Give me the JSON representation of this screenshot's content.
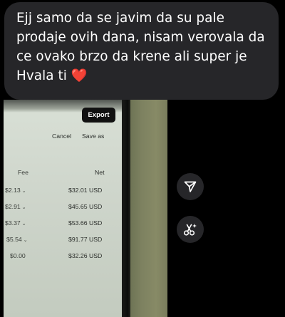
{
  "message": {
    "text": "Ejj samo da se javim da su pale prodaje ovih dana, nisam verovala da ce ovako brzo da krene ali super je Hvala ti",
    "emoji": "❤️"
  },
  "screenshot": {
    "export_label": "Export",
    "cancel_label": "Cancel",
    "save_as_label": "Save as",
    "fee_header": "Fee",
    "net_header": "Net",
    "rows": [
      {
        "fee": "$2.13",
        "net": "$32.01 USD"
      },
      {
        "fee": "$2.91",
        "net": "$45.65 USD"
      },
      {
        "fee": "$3.37",
        "net": "$53.66 USD"
      },
      {
        "fee": "$5.54",
        "net": "$91.77 USD"
      },
      {
        "fee": "$0.00",
        "net": "$32.26 USD"
      }
    ]
  },
  "actions": {
    "share_icon": "send-icon",
    "ai_icon": "scissors-sparkle-icon"
  },
  "colors": {
    "background": "#000000",
    "bubble": "#262629",
    "heart": "#ea2432"
  }
}
